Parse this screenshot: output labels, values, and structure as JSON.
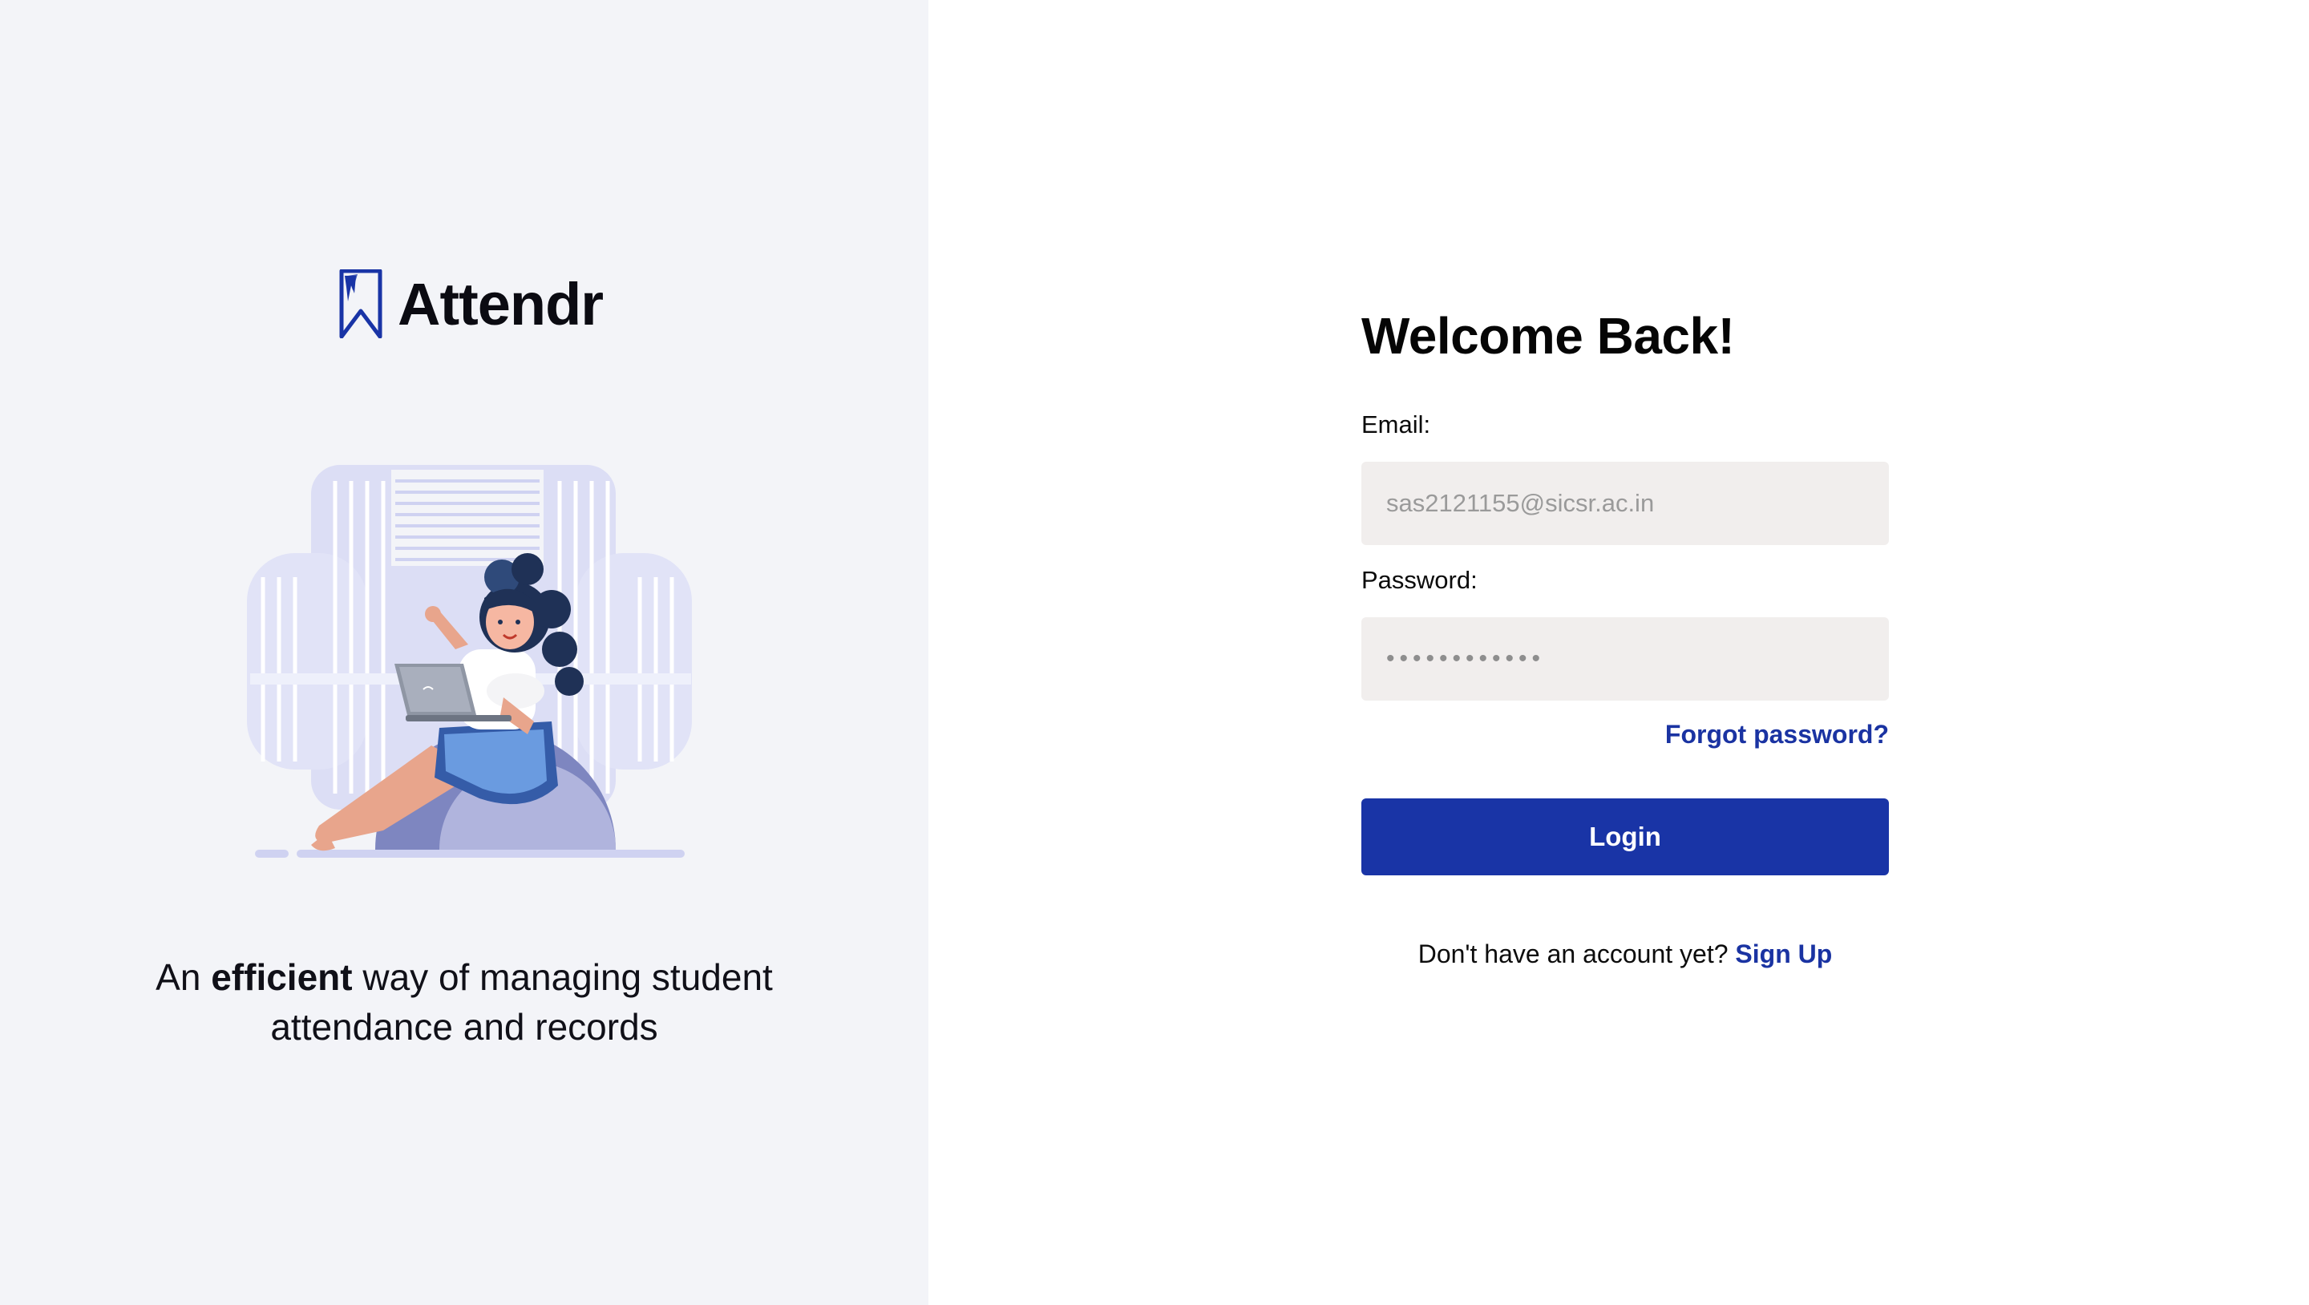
{
  "brand": {
    "name": "Attendr",
    "logo_icon": "bookmark-logo-icon",
    "accent_color": "#1934a6"
  },
  "hero": {
    "illustration": "woman-with-laptop-illustration"
  },
  "tagline": {
    "before": "An ",
    "emphasis": "efficient",
    "after": " way of managing student attendance and records"
  },
  "login": {
    "title": "Welcome Back!",
    "email_label": "Email:",
    "email_placeholder": "sas2121155@sicsr.ac.in",
    "password_label": "Password:",
    "password_value": "••••••••••••",
    "forgot_label": "Forgot password?",
    "login_label": "Login",
    "signup_prompt": "Don't have an account yet?",
    "signup_label": "Sign Up"
  },
  "colors": {
    "left_panel_bg": "#f3f4f8",
    "input_bg": "#f1eeed",
    "button_bg": "#1934a6",
    "link": "#1a33a2"
  }
}
